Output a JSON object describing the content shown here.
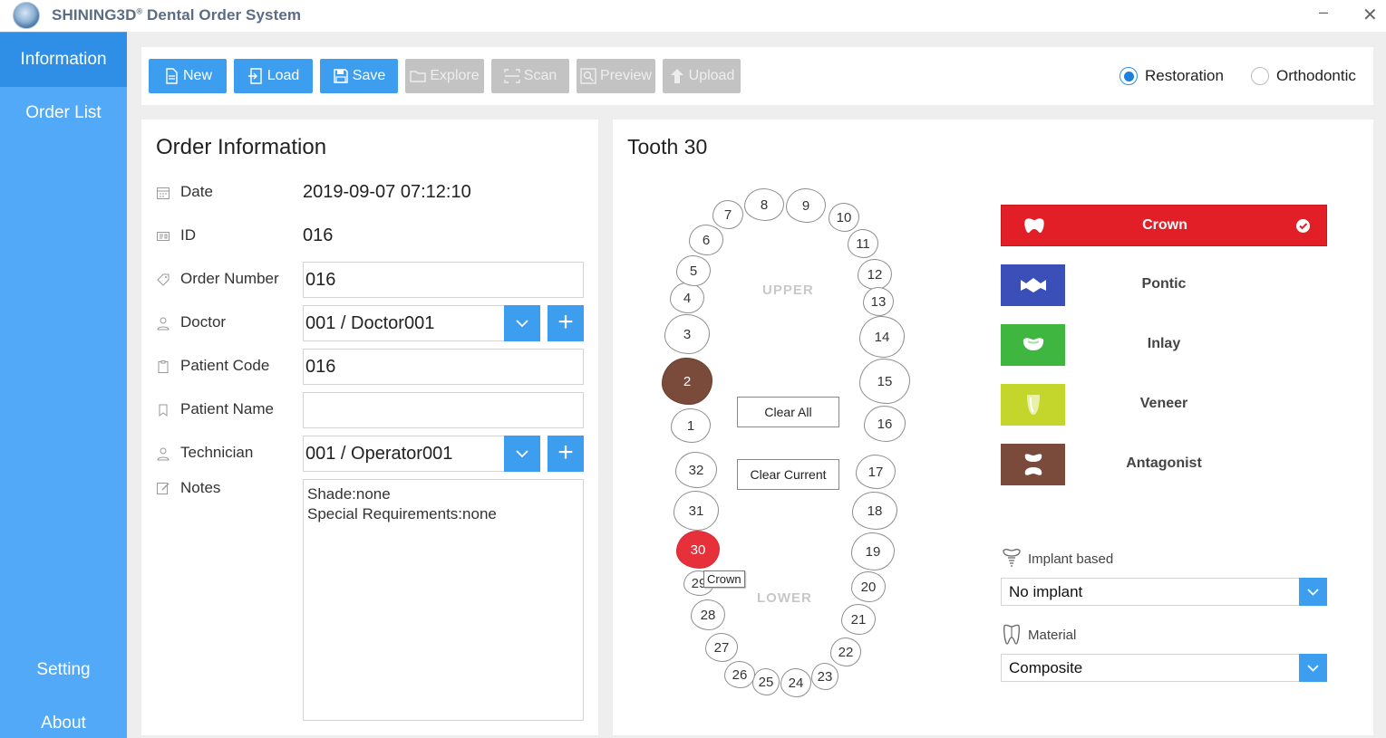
{
  "app": {
    "title": "SHINING3D",
    "title_mark": "®",
    "title_rest": " Dental Order System"
  },
  "sidebar": {
    "items": [
      {
        "label": "Information",
        "active": true
      },
      {
        "label": "Order List"
      },
      {
        "label": "Setting"
      },
      {
        "label": "About"
      }
    ]
  },
  "toolbar": {
    "new": "New",
    "load": "Load",
    "save": "Save",
    "explore": "Explore",
    "scan": "Scan",
    "preview": "Preview",
    "upload": "Upload",
    "mode_restoration": "Restoration",
    "mode_orthodontic": "Orthodontic",
    "selected_mode": "Restoration"
  },
  "order": {
    "title": "Order Information",
    "date_label": "Date",
    "date_value": "2019-09-07 07:12:10",
    "id_label": "ID",
    "id_value": "016",
    "order_number_label": "Order Number",
    "order_number_value": "016",
    "doctor_label": "Doctor",
    "doctor_value": "001 / Doctor001",
    "patient_code_label": "Patient Code",
    "patient_code_value": "016",
    "patient_name_label": "Patient Name",
    "patient_name_value": "",
    "technician_label": "Technician",
    "technician_value": "001 / Operator001",
    "notes_label": "Notes",
    "notes_value": "Shade:none\nSpecial Requirements:none"
  },
  "tooth_panel": {
    "title": "Tooth 30",
    "upper_label": "UPPER",
    "lower_label": "LOWER",
    "clear_all": "Clear All",
    "clear_current": "Clear Current",
    "tooltip": "Crown",
    "teeth": [
      {
        "n": "1"
      },
      {
        "n": "2",
        "state": "antagonist"
      },
      {
        "n": "3"
      },
      {
        "n": "4"
      },
      {
        "n": "5"
      },
      {
        "n": "6"
      },
      {
        "n": "7"
      },
      {
        "n": "8"
      },
      {
        "n": "9"
      },
      {
        "n": "10"
      },
      {
        "n": "11"
      },
      {
        "n": "12"
      },
      {
        "n": "13"
      },
      {
        "n": "14"
      },
      {
        "n": "15"
      },
      {
        "n": "16"
      },
      {
        "n": "17"
      },
      {
        "n": "18"
      },
      {
        "n": "19"
      },
      {
        "n": "20"
      },
      {
        "n": "21"
      },
      {
        "n": "22"
      },
      {
        "n": "23"
      },
      {
        "n": "24"
      },
      {
        "n": "25"
      },
      {
        "n": "26"
      },
      {
        "n": "27"
      },
      {
        "n": "28"
      },
      {
        "n": "29"
      },
      {
        "n": "30",
        "state": "crown"
      },
      {
        "n": "31"
      },
      {
        "n": "32"
      }
    ],
    "restoration_types": [
      {
        "label": "Crown",
        "color": "#e21e26",
        "selected": true
      },
      {
        "label": "Pontic",
        "color": "#3a4fb8"
      },
      {
        "label": "Inlay",
        "color": "#3fb63f"
      },
      {
        "label": "Veneer",
        "color": "#c4d62c"
      },
      {
        "label": "Antagonist",
        "color": "#7a4a3a"
      }
    ],
    "implant_label": "Implant based",
    "implant_value": "No implant",
    "material_label": "Material",
    "material_value": "Composite"
  }
}
